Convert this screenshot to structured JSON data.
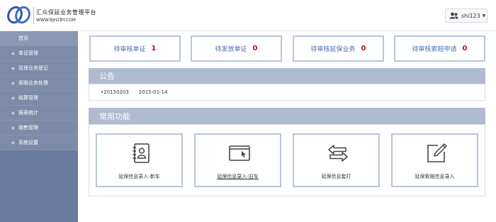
{
  "header": {
    "brand_title": "汇众保延业务管理平台",
    "brand_sub": "WWW.BJHZBY.COM",
    "user_name": "shi123",
    "user_icon": "users-icon",
    "caret": "▼"
  },
  "sidebar": {
    "home": "首页",
    "items": [
      {
        "prefix": "+",
        "label": "单证管理"
      },
      {
        "prefix": "+",
        "label": "延保业务登记"
      },
      {
        "prefix": "+",
        "label": "索赔业务处理"
      },
      {
        "prefix": "+",
        "label": "结算管理"
      },
      {
        "prefix": "+",
        "label": "报表统计"
      },
      {
        "prefix": "+",
        "label": "销售管理"
      },
      {
        "prefix": "+",
        "label": "系统设置"
      }
    ]
  },
  "stats": [
    {
      "label": "待审核单证",
      "count": "1"
    },
    {
      "label": "待发放单证",
      "count": "0"
    },
    {
      "label": "待审核延保业务",
      "count": "0"
    },
    {
      "label": "待审核索赔申请",
      "count": "0"
    }
  ],
  "notice": {
    "title": "公告",
    "bullet": "•",
    "item_text": "20150203",
    "item_date": "2015-01-14"
  },
  "functions": {
    "title": "常用功能",
    "items": [
      {
        "label": "延保信息录入-新车",
        "icon": "address-book-icon"
      },
      {
        "label": "延保信息录入-旧车",
        "icon": "window-cursor-icon"
      },
      {
        "label": "延保信息套打",
        "icon": "exchange-arrows-icon"
      },
      {
        "label": "延保索赔信息录入",
        "icon": "edit-pen-icon"
      }
    ]
  },
  "colors": {
    "sidebar": "#6a7c9d",
    "panel_head": "#b0bbd0",
    "card_border": "#b9c5db",
    "stat_text": "#4a6fb0",
    "count_red": "#d4001a"
  }
}
